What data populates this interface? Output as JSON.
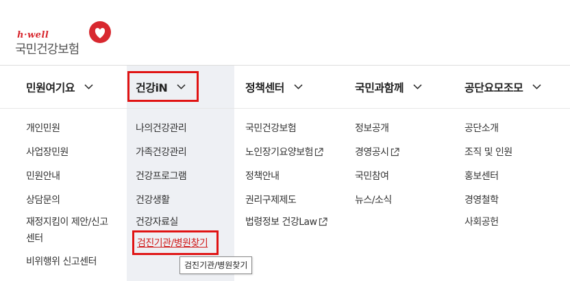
{
  "logo": {
    "tagline": "h·well",
    "name": "국민건강보험",
    "brand_color": "#d8282f"
  },
  "nav": {
    "items": [
      {
        "label": "민원여기요",
        "icon": "chevron-down-icon"
      },
      {
        "label": "건강iN",
        "icon": "chevron-down-icon",
        "active": true
      },
      {
        "label": "정책센터",
        "icon": "chevron-down-icon"
      },
      {
        "label": "국민과함께",
        "icon": "chevron-down-icon"
      },
      {
        "label": "공단요모조모",
        "icon": "chevron-down-icon"
      }
    ]
  },
  "menus": {
    "civil": [
      "개인민원",
      "사업장민원",
      "민원안내",
      "상담문의",
      "재정지킴이 제안/신고",
      "센터",
      "비위행위 신고센터"
    ],
    "health": [
      "나의건강관리",
      "가족건강관리",
      "건강프로그램",
      "건강생활",
      "건강자료실",
      "검진기관/병원찾기"
    ],
    "policy": [
      "국민건강보험",
      "노인장기요양보험",
      "정책안내",
      "권리구제제도",
      "법령정보 건강Law"
    ],
    "together": [
      "정보공개",
      "경영공시",
      "국민참여",
      "뉴스/소식"
    ],
    "about": [
      "공단소개",
      "조직 및 인원",
      "홍보센터",
      "경영철학",
      "사회공헌"
    ]
  },
  "tooltip": {
    "text": "검진기관/병원찾기"
  },
  "colors": {
    "highlight": "#e01313",
    "active_column_bg": "#eef0f4"
  }
}
